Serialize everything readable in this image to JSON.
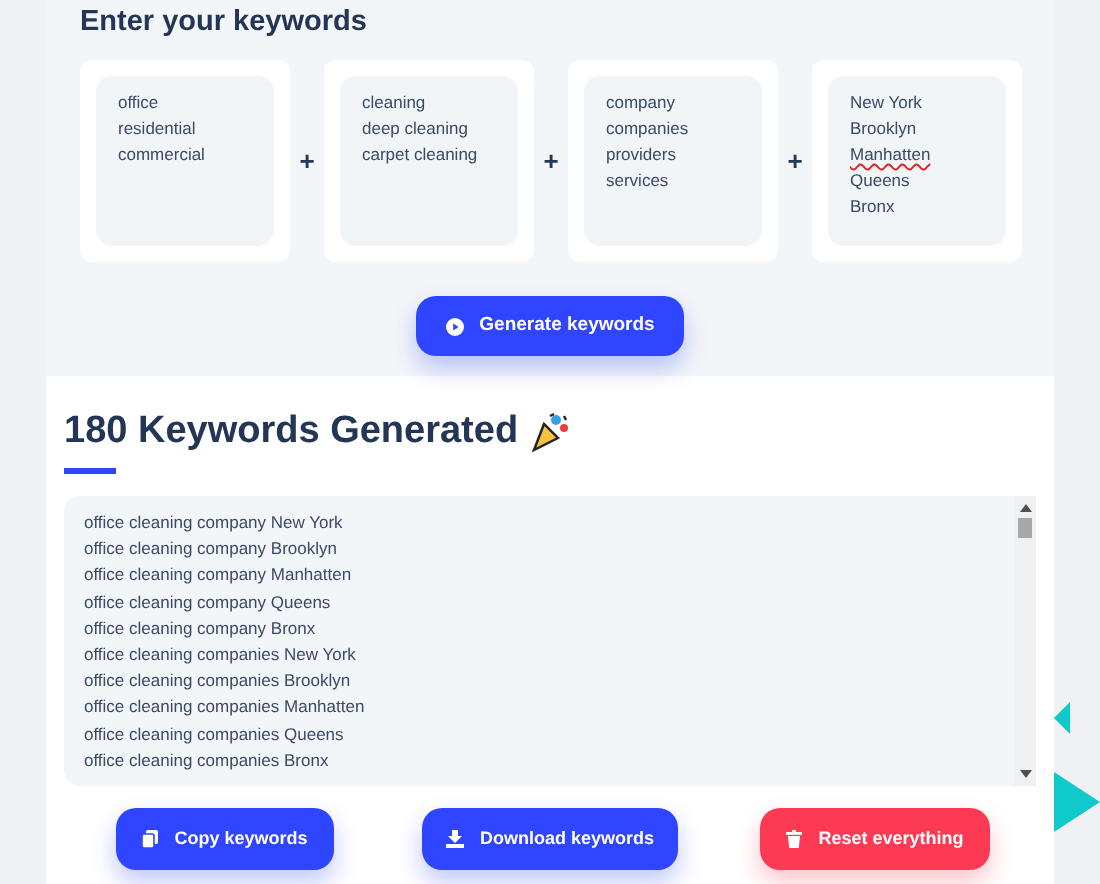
{
  "input_section": {
    "title": "Enter your keywords",
    "groups": [
      {
        "items": [
          {
            "text": "office",
            "misspelled": false
          },
          {
            "text": "residential",
            "misspelled": false
          },
          {
            "text": "commercial",
            "misspelled": false
          }
        ]
      },
      {
        "items": [
          {
            "text": "cleaning",
            "misspelled": false
          },
          {
            "text": "deep cleaning",
            "misspelled": false
          },
          {
            "text": "carpet cleaning",
            "misspelled": false
          }
        ]
      },
      {
        "items": [
          {
            "text": "company",
            "misspelled": false
          },
          {
            "text": "companies",
            "misspelled": false
          },
          {
            "text": "providers",
            "misspelled": false
          },
          {
            "text": "services",
            "misspelled": false
          }
        ]
      },
      {
        "items": [
          {
            "text": "New York",
            "misspelled": false
          },
          {
            "text": "Brooklyn",
            "misspelled": false
          },
          {
            "text": "Manhatten",
            "misspelled": true
          },
          {
            "text": "Queens",
            "misspelled": false
          },
          {
            "text": "Bronx",
            "misspelled": false
          }
        ]
      }
    ],
    "separators": [
      "+",
      "+",
      "+"
    ],
    "generate_button": "Generate keywords"
  },
  "results": {
    "title": "180 Keywords Generated",
    "lines": [
      "office cleaning company New York",
      "office cleaning company Brooklyn",
      "office cleaning company Manhatten",
      "office cleaning company Queens",
      "office cleaning company Bronx",
      "office cleaning companies New York",
      "office cleaning companies Brooklyn",
      "office cleaning companies Manhatten",
      "office cleaning companies Queens",
      "office cleaning companies Bronx"
    ],
    "buttons": [
      {
        "kind": "copy",
        "label": "Copy keywords"
      },
      {
        "kind": "download",
        "label": "Download keywords"
      },
      {
        "kind": "reset",
        "label": "Reset everything"
      }
    ]
  }
}
